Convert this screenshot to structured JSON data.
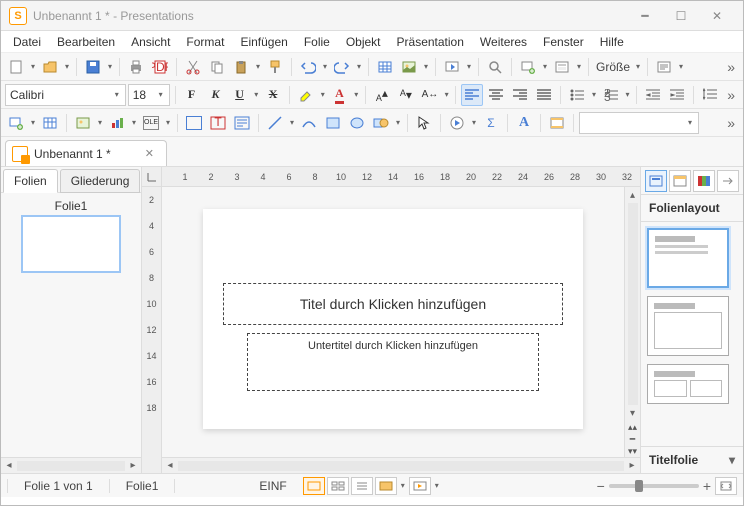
{
  "titlebar": {
    "title": "Unbenannt 1 * - Presentations"
  },
  "menu": {
    "items": [
      "Datei",
      "Bearbeiten",
      "Ansicht",
      "Format",
      "Einfügen",
      "Folie",
      "Objekt",
      "Präsentation",
      "Weiteres",
      "Fenster",
      "Hilfe"
    ]
  },
  "toolbar1": {
    "size_label": "Größe"
  },
  "toolbar2": {
    "font": "Calibri",
    "size": "18"
  },
  "toolbar3": {},
  "doc_tab": {
    "label": "Unbenannt 1 *"
  },
  "left_pane": {
    "tab_slides": "Folien",
    "tab_outline": "Gliederung",
    "slide1_label": "Folie1"
  },
  "ruler": {
    "h": [
      "1",
      "2",
      "3",
      "4",
      "6",
      "8",
      "10",
      "12",
      "14",
      "16",
      "18",
      "20",
      "22",
      "24",
      "26",
      "28",
      "30",
      "32"
    ],
    "v": [
      "2",
      "4",
      "6",
      "8",
      "10",
      "12",
      "14",
      "16",
      "18"
    ]
  },
  "slide": {
    "title_ph": "Titel durch Klicken hinzufügen",
    "subtitle_ph": "Untertitel durch Klicken hinzufügen"
  },
  "right_pane": {
    "title": "Folienlayout",
    "footer": "Titelfolie"
  },
  "status": {
    "page": "Folie 1 von 1",
    "name": "Folie1",
    "mode": "EINF"
  }
}
